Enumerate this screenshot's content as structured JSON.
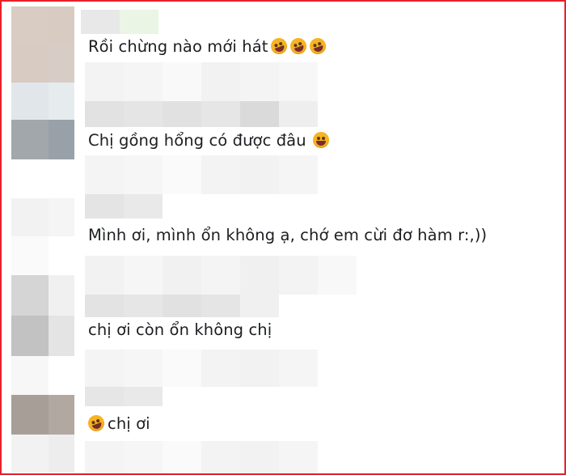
{
  "comments": [
    {
      "text": "Rồi chừng nào mới hát",
      "emoji_before": 0,
      "emoji_after": 3,
      "emoji_name": "rofl-emoji"
    },
    {
      "text": "Chị gồng hổng có được đâu",
      "emoji_before": 0,
      "emoji_after": 1,
      "emoji_name": "tears-of-joy-emoji"
    },
    {
      "text": "Mình ơi, mình ổn không ạ, chớ em cừi đơ hàm r:,))",
      "emoji_before": 0,
      "emoji_after": 0,
      "emoji_name": ""
    },
    {
      "text": "chị ơi còn ổn không chị",
      "emoji_before": 0,
      "emoji_after": 0,
      "emoji_name": ""
    },
    {
      "text": "chị ơi",
      "emoji_before": 1,
      "emoji_after": 0,
      "emoji_name": "rofl-emoji"
    }
  ],
  "colors": {
    "border": "#e8202a",
    "text": "#1c1e21",
    "emoji": "#f7b321"
  }
}
